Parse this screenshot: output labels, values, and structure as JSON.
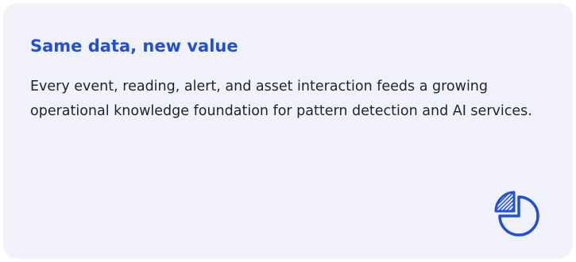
{
  "card": {
    "title": "Same data, new value",
    "body": "Every event, reading, alert, and asset interaction feeds a growing operational knowledge foundation for pattern detection and AI services.",
    "icon": "pie-chart-icon"
  },
  "colors": {
    "accent": "#2050d6",
    "card_background": "#f1f2f9",
    "text": "#1f2230"
  }
}
